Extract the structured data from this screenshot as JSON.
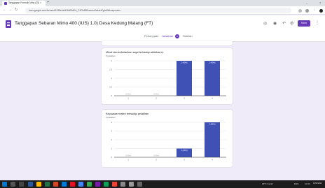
{
  "browser": {
    "tab_title": "Tanggapan Formulir Mina (25) ×",
    "new_tab": "+",
    "url": "docs.google.com/forms/d/1Kf0e4aHtJbNDt4Eo_C2Gn85t2wcmoKwIaUKg/edit#responses",
    "minimize": "–",
    "close": "×"
  },
  "header": {
    "form_title": "Tanggapan Sebaran Mimo 400 (IUS) 1.0) Desa Kedung Malang (FT)",
    "send_label": "Kirim",
    "tabs": [
      {
        "label": "Pertanyaan"
      },
      {
        "label": "Jawaban"
      },
      {
        "label": "Setelan"
      }
    ],
    "response_count": "5"
  },
  "questions": [
    {
      "title": "Minat dan ketertarikan saya terhadap aktivitas ini",
      "count": "5 jawaban",
      "chart_data": {
        "type": "bar",
        "categories": [
          "1",
          "2",
          "3",
          "4"
        ],
        "values": [
          0,
          0,
          2,
          2
        ],
        "value_labels": [
          "0 (0%)",
          "0 (0%)",
          "2 (40%)",
          "2 (40%)"
        ],
        "ylim": [
          0,
          2
        ],
        "yticks": [
          "0",
          "0.5",
          "1",
          "1.5",
          "2"
        ],
        "color": "#3f51b5"
      }
    },
    {
      "title": "Kepuasan materi terhadap pelatihan",
      "count": "5 jawaban",
      "chart_data": {
        "type": "bar",
        "categories": [
          "1",
          "2",
          "3",
          "4"
        ],
        "values": [
          0,
          0,
          1,
          4
        ],
        "value_labels": [
          "0 (0%)",
          "0 (0%)",
          "1 (20%)",
          "4 (80%)"
        ],
        "ylim": [
          0,
          4
        ],
        "yticks": [
          "0",
          "1",
          "2",
          "3",
          "4"
        ],
        "color": "#3f51b5"
      }
    }
  ],
  "taskbar": {
    "weather": "29°C Cerah",
    "time": "10:44",
    "date": "15/09/2022",
    "lang": "ENG"
  }
}
